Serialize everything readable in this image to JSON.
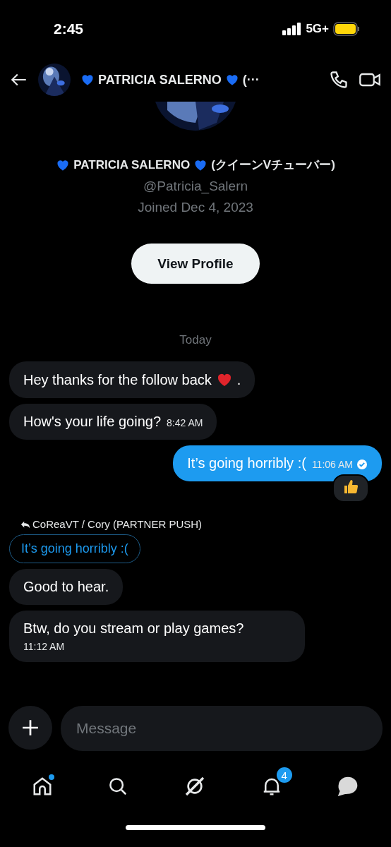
{
  "status_bar": {
    "time": "2:45",
    "network": "5G+"
  },
  "header": {
    "title": [
      {
        "kind": "heart"
      },
      {
        "kind": "text",
        "text": "PATRICIA SALERNO"
      },
      {
        "kind": "heart"
      },
      {
        "kind": "text",
        "text": "(···"
      }
    ]
  },
  "profile": {
    "name": [
      {
        "kind": "heart"
      },
      {
        "kind": "text",
        "text": "PATRICIA SALERNO"
      },
      {
        "kind": "heart"
      },
      {
        "kind": "text",
        "text": "(クイーンVチューバー)"
      }
    ],
    "handle": "@Patricia_Salern",
    "joined": "Joined Dec 4, 2023",
    "button": "View Profile"
  },
  "day_label": "Today",
  "messages": [
    {
      "kind": "received",
      "segments": [
        {
          "kind": "text",
          "text": "Hey thanks for the follow back"
        },
        {
          "kind": "heart"
        },
        {
          "kind": "text",
          "text": "."
        }
      ]
    },
    {
      "kind": "received",
      "segments": [
        {
          "kind": "text",
          "text": "How's your life going?"
        }
      ],
      "time": "8:42 AM",
      "read": false,
      "time_below": false
    },
    {
      "kind": "sent",
      "segments": [
        {
          "kind": "text",
          "text": "It’s going horribly :("
        }
      ],
      "time": "11:06 AM",
      "read": true,
      "time_below": false,
      "thumbs_up_reaction": true
    },
    {
      "kind": "reply",
      "author": "CoReaVT / Cory (PARTNER PUSH)",
      "quote": "It’s going horribly :("
    },
    {
      "kind": "received",
      "segments": [
        {
          "kind": "text",
          "text": "Good to hear."
        }
      ]
    },
    {
      "kind": "received",
      "segments": [
        {
          "kind": "text",
          "text": "Btw, do you stream or play games?"
        }
      ],
      "time": "11:12 AM",
      "read": false,
      "time_below": true
    }
  ],
  "composer": {
    "placeholder": "Message"
  },
  "nav": [
    {
      "kind": "home",
      "selected": false,
      "dot": true
    },
    {
      "kind": "search",
      "selected": false,
      "dot": false
    },
    {
      "kind": "grok",
      "selected": false,
      "dot": false
    },
    {
      "kind": "bell",
      "selected": false,
      "badge": "4"
    },
    {
      "kind": "messages",
      "selected": true,
      "dot": false
    }
  ]
}
